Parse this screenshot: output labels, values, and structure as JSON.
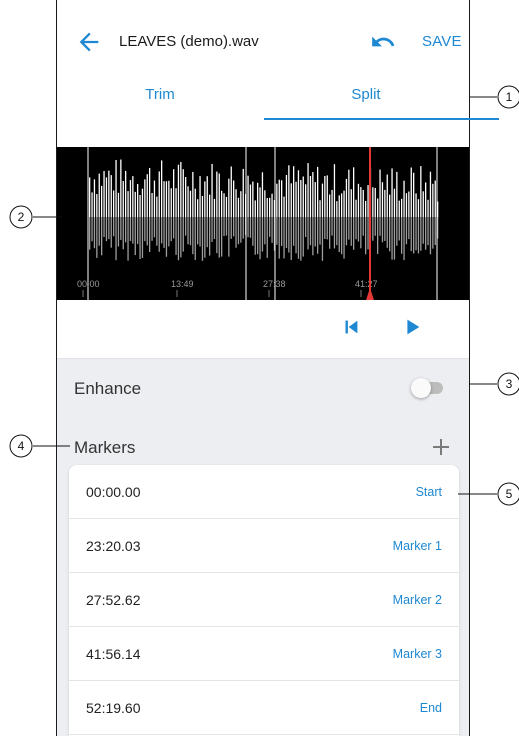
{
  "header": {
    "title": "LEAVES (demo).wav",
    "save_label": "SAVE",
    "back_icon": "arrow-left-icon",
    "undo_icon": "undo-icon"
  },
  "tabs": [
    {
      "label": "Trim",
      "active": false
    },
    {
      "label": "Split",
      "active": true
    }
  ],
  "waveform": {
    "time_labels": [
      "00:00",
      "13:49",
      "27:38",
      "41:27"
    ],
    "background": "#000000",
    "playhead_color": "#e53935"
  },
  "playback": {
    "skip_back_icon": "skip-to-start-icon",
    "play_icon": "play-icon"
  },
  "enhance": {
    "label": "Enhance",
    "enabled": false
  },
  "markers": {
    "label": "Markers",
    "add_icon": "plus-icon",
    "items": [
      {
        "time": "00:00.00",
        "label": "Start"
      },
      {
        "time": "23:20.03",
        "label": "Marker 1"
      },
      {
        "time": "27:52.62",
        "label": "Marker 2"
      },
      {
        "time": "41:56.14",
        "label": "Marker 3"
      },
      {
        "time": "52:19.60",
        "label": "End"
      }
    ]
  },
  "callouts": [
    "1",
    "2",
    "3",
    "4",
    "5"
  ],
  "colors": {
    "accent": "#1e88d2",
    "panel_bg": "#eceef1",
    "toggle_off": "#bdbdbd"
  }
}
